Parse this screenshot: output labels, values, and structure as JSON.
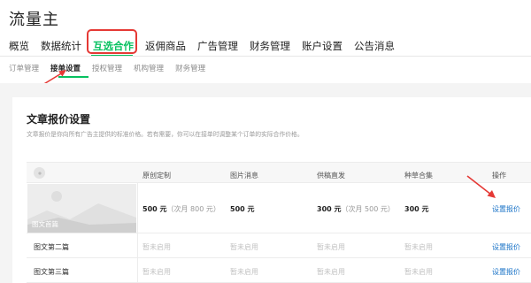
{
  "app": {
    "title": "流量主"
  },
  "main_nav": {
    "tabs": [
      {
        "label": "概览"
      },
      {
        "label": "数据统计"
      },
      {
        "label": "互选合作"
      },
      {
        "label": "返佣商品"
      },
      {
        "label": "广告管理"
      },
      {
        "label": "财务管理"
      },
      {
        "label": "账户设置"
      },
      {
        "label": "公告消息"
      }
    ],
    "active_index": 2
  },
  "sub_nav": {
    "tabs": [
      {
        "label": "订单管理"
      },
      {
        "label": "接单设置"
      },
      {
        "label": "授权管理"
      },
      {
        "label": "机构管理"
      },
      {
        "label": "财务管理"
      }
    ],
    "active_index": 1
  },
  "card": {
    "title": "文章报价设置",
    "description": "文章报价是你向所有广告主提供的标准价格。若有需要，你可以在接单时调整某个订单的实际合作价格。"
  },
  "table": {
    "columns": [
      "原创定制",
      "图片消息",
      "供稿直发",
      "种草合集",
      "操作"
    ],
    "rows": [
      {
        "name": "图文首篇",
        "original": {
          "price": "500 元",
          "note": "（次月 800 元）"
        },
        "image_msg": {
          "price": "500 元"
        },
        "supply": {
          "price": "300 元",
          "note": "（次月 500 元）"
        },
        "collection": {
          "price": "300 元"
        },
        "action": "设置报价"
      },
      {
        "name": "图文第二篇",
        "original": "暂未启用",
        "image_msg": "暂未启用",
        "supply": "暂未启用",
        "collection": "暂未启用",
        "action": "设置报价"
      },
      {
        "name": "图文第三篇",
        "original": "暂未启用",
        "image_msg": "暂未启用",
        "supply": "暂未启用",
        "collection": "暂未启用",
        "action": "设置报价"
      }
    ]
  },
  "colors": {
    "accent": "#07c160",
    "highlight": "#e53935",
    "link": "#1a73c7",
    "muted": "#c3c3c3"
  },
  "icons": {
    "header_icon": "image-placeholder-icon",
    "annotation": "red-arrow-icon"
  }
}
